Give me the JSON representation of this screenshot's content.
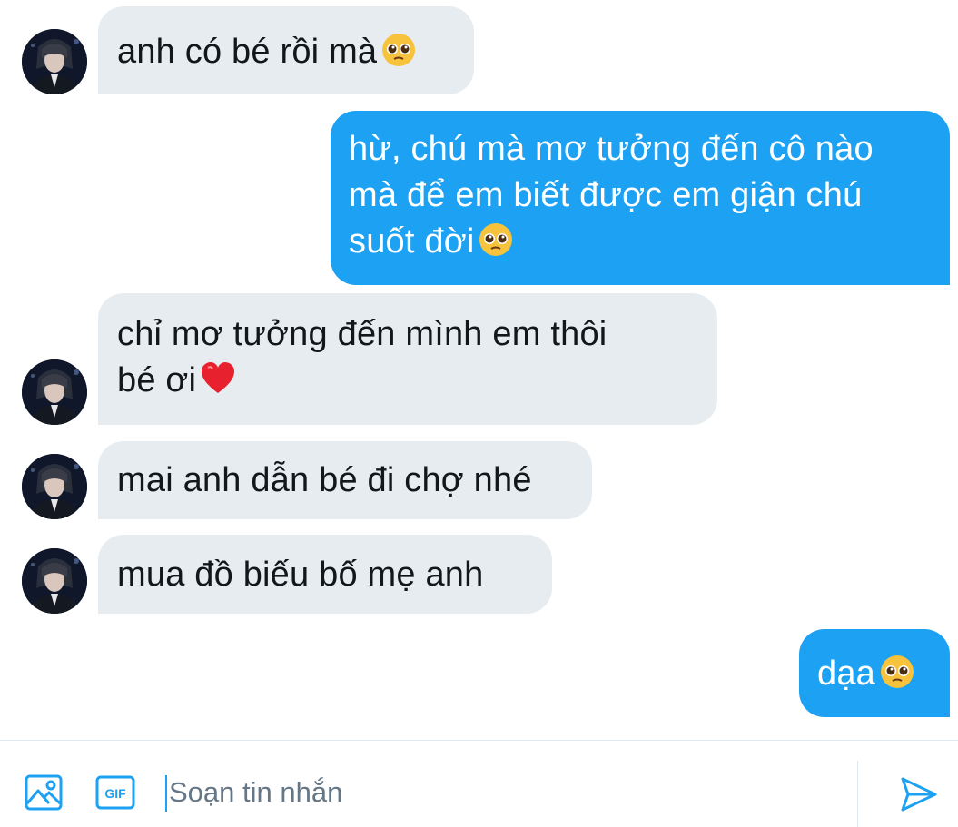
{
  "messages": [
    {
      "side": "in",
      "line1": "anh có bé rồi mà",
      "emoji": "pleading-face"
    },
    {
      "side": "out",
      "line1": "hừ, chú mà mơ tưởng đến cô nào",
      "line2": "mà để em biết được em giận chú",
      "line3": "suốt đời",
      "emoji": "pleading-face"
    },
    {
      "side": "in",
      "line1": "chỉ mơ tưởng đến mình em thôi",
      "line2": "bé ơi",
      "emoji": "red-heart"
    },
    {
      "side": "in",
      "line1": "mai anh dẫn bé đi chợ nhé"
    },
    {
      "side": "in",
      "line1": "mua đồ biếu bố mẹ anh"
    },
    {
      "side": "out",
      "line1": "dạa",
      "emoji": "pleading-face"
    }
  ],
  "composer": {
    "placeholder": "Soạn tin nhắn",
    "gif_label": "GIF",
    "icons": [
      "image-icon",
      "gif-icon",
      "send-icon"
    ]
  },
  "colors": {
    "incoming_bubble": "#e6ecf0",
    "outgoing_bubble": "#1da1f2",
    "accent": "#1da1f2"
  }
}
